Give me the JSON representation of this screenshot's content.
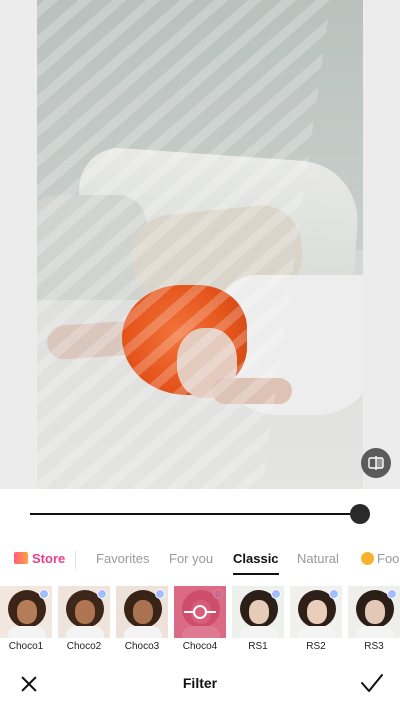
{
  "header": {},
  "slider": {
    "value_fraction": 1.0
  },
  "tabs": [
    {
      "label": "Store",
      "active": false
    },
    {
      "label": "Favorites",
      "active": false
    },
    {
      "label": "For you",
      "active": false
    },
    {
      "label": "Classic",
      "active": true
    },
    {
      "label": "Natural",
      "active": false
    },
    {
      "label": "Foo",
      "active": false
    }
  ],
  "filters": [
    {
      "label": "Choco1",
      "selected": false,
      "premium": true
    },
    {
      "label": "Choco2",
      "selected": false,
      "premium": true
    },
    {
      "label": "Choco3",
      "selected": false,
      "premium": true
    },
    {
      "label": "Choco4",
      "selected": true,
      "premium": true
    },
    {
      "label": "RS1",
      "selected": false,
      "premium": true
    },
    {
      "label": "RS2",
      "selected": false,
      "premium": true
    },
    {
      "label": "RS3",
      "selected": false,
      "premium": true
    }
  ],
  "bottombar": {
    "title": "Filter",
    "close_icon": "close-icon",
    "apply_icon": "checkmark-icon"
  },
  "colors": {
    "store_accent": "#e83f86",
    "active_tab": "#111111",
    "selected_overlay": "#d64c6c"
  }
}
